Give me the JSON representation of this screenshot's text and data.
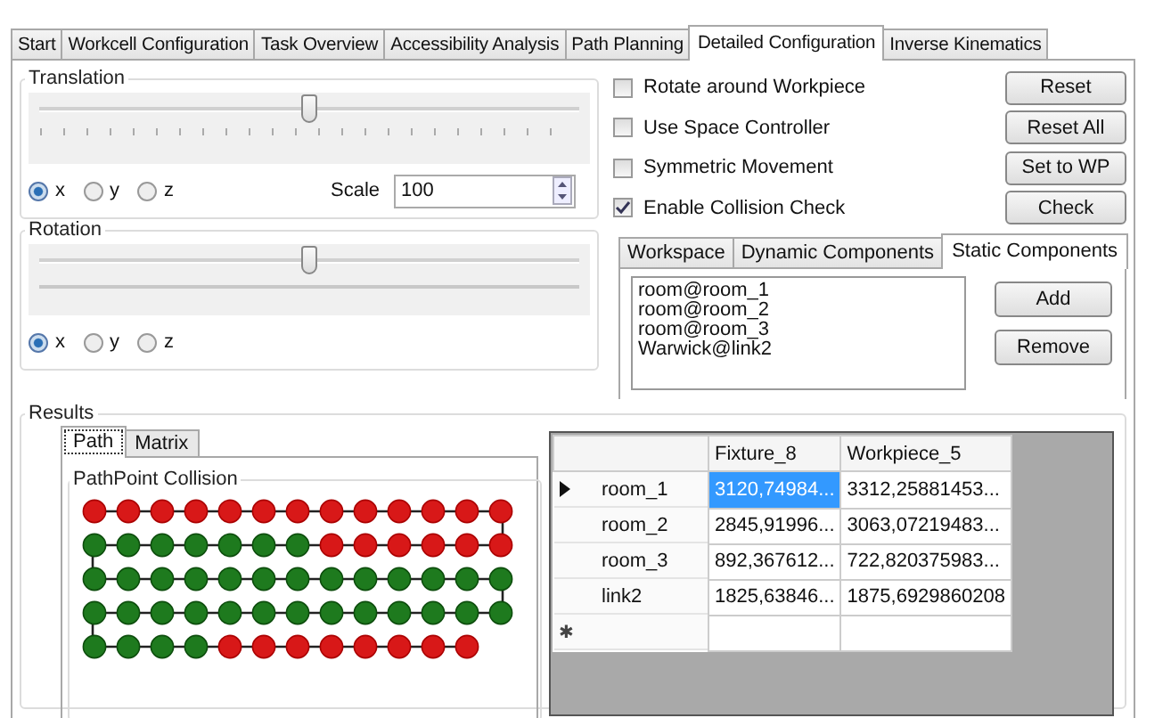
{
  "tabs": [
    {
      "label": "Start",
      "selected": false
    },
    {
      "label": "Workcell Configuration",
      "selected": false
    },
    {
      "label": "Task Overview",
      "selected": false
    },
    {
      "label": "Accessibility Analysis",
      "selected": false
    },
    {
      "label": "Path Planning",
      "selected": false
    },
    {
      "label": "Detailed Configuration",
      "selected": true
    },
    {
      "label": "Inverse Kinematics",
      "selected": false
    }
  ],
  "translation": {
    "title": "Translation",
    "level": 0.5,
    "ticks": true,
    "axes": [
      {
        "label": "x",
        "selected": true
      },
      {
        "label": "y",
        "selected": false
      },
      {
        "label": "z",
        "selected": false
      }
    ],
    "scale_label": "Scale",
    "scale_value": "100"
  },
  "rotation": {
    "title": "Rotation",
    "level": 0.5,
    "ticks": false,
    "axes": [
      {
        "label": "x",
        "selected": true
      },
      {
        "label": "y",
        "selected": false
      },
      {
        "label": "z",
        "selected": false
      }
    ]
  },
  "options": [
    {
      "label": "Rotate around Workpiece",
      "checked": false,
      "button": "Reset"
    },
    {
      "label": "Use Space Controller",
      "checked": false,
      "button": "Reset All"
    },
    {
      "label": "Symmetric Movement",
      "checked": false,
      "button": "Set to WP"
    },
    {
      "label": "Enable Collision Check",
      "checked": true,
      "button": "Check"
    }
  ],
  "component_tabs": [
    {
      "label": "Workspace",
      "selected": false
    },
    {
      "label": "Dynamic Components",
      "selected": false
    },
    {
      "label": "Static Components",
      "selected": true
    }
  ],
  "static_components": [
    "room@room_1",
    "room@room_2",
    "room@room_3",
    "Warwick@link2"
  ],
  "component_buttons": [
    "Add",
    "Remove"
  ],
  "results": {
    "title": "Results",
    "tabs": [
      {
        "label": "Path",
        "selected": true
      },
      {
        "label": "Matrix",
        "selected": false
      }
    ],
    "collision_title": "PathPoint Collision",
    "path_rows": [
      {
        "points": [
          true,
          true,
          true,
          true,
          true,
          true,
          true,
          true,
          true,
          true,
          true,
          true,
          true
        ]
      },
      {
        "points": [
          false,
          false,
          false,
          false,
          false,
          false,
          false,
          true,
          true,
          true,
          true,
          true,
          true
        ]
      },
      {
        "points": [
          false,
          false,
          false,
          false,
          false,
          false,
          false,
          false,
          false,
          false,
          false,
          false,
          false
        ]
      },
      {
        "points": [
          false,
          false,
          false,
          false,
          false,
          false,
          false,
          false,
          false,
          false,
          false,
          false,
          false
        ]
      },
      {
        "points": [
          false,
          false,
          false,
          false,
          true,
          true,
          true,
          true,
          true,
          true,
          true,
          true
        ]
      }
    ],
    "table": {
      "columns": [
        "Fixture_8",
        "Workpiece_5"
      ],
      "rows": [
        {
          "name": "room_1",
          "current": true,
          "cells": [
            {
              "text": "3120,74984...",
              "selected": true
            },
            {
              "text": "3312,25881453...",
              "selected": false
            }
          ]
        },
        {
          "name": "room_2",
          "current": false,
          "cells": [
            {
              "text": "2845,91996...",
              "selected": false
            },
            {
              "text": "3063,07219483...",
              "selected": false
            }
          ]
        },
        {
          "name": "room_3",
          "current": false,
          "cells": [
            {
              "text": "892,367612...",
              "selected": false
            },
            {
              "text": "722,820375983...",
              "selected": false
            }
          ]
        },
        {
          "name": "link2",
          "current": false,
          "cells": [
            {
              "text": "1825,63846...",
              "selected": false
            },
            {
              "text": "1875,6929860208",
              "selected": false
            }
          ]
        }
      ],
      "new_row_marker": "✱"
    }
  }
}
